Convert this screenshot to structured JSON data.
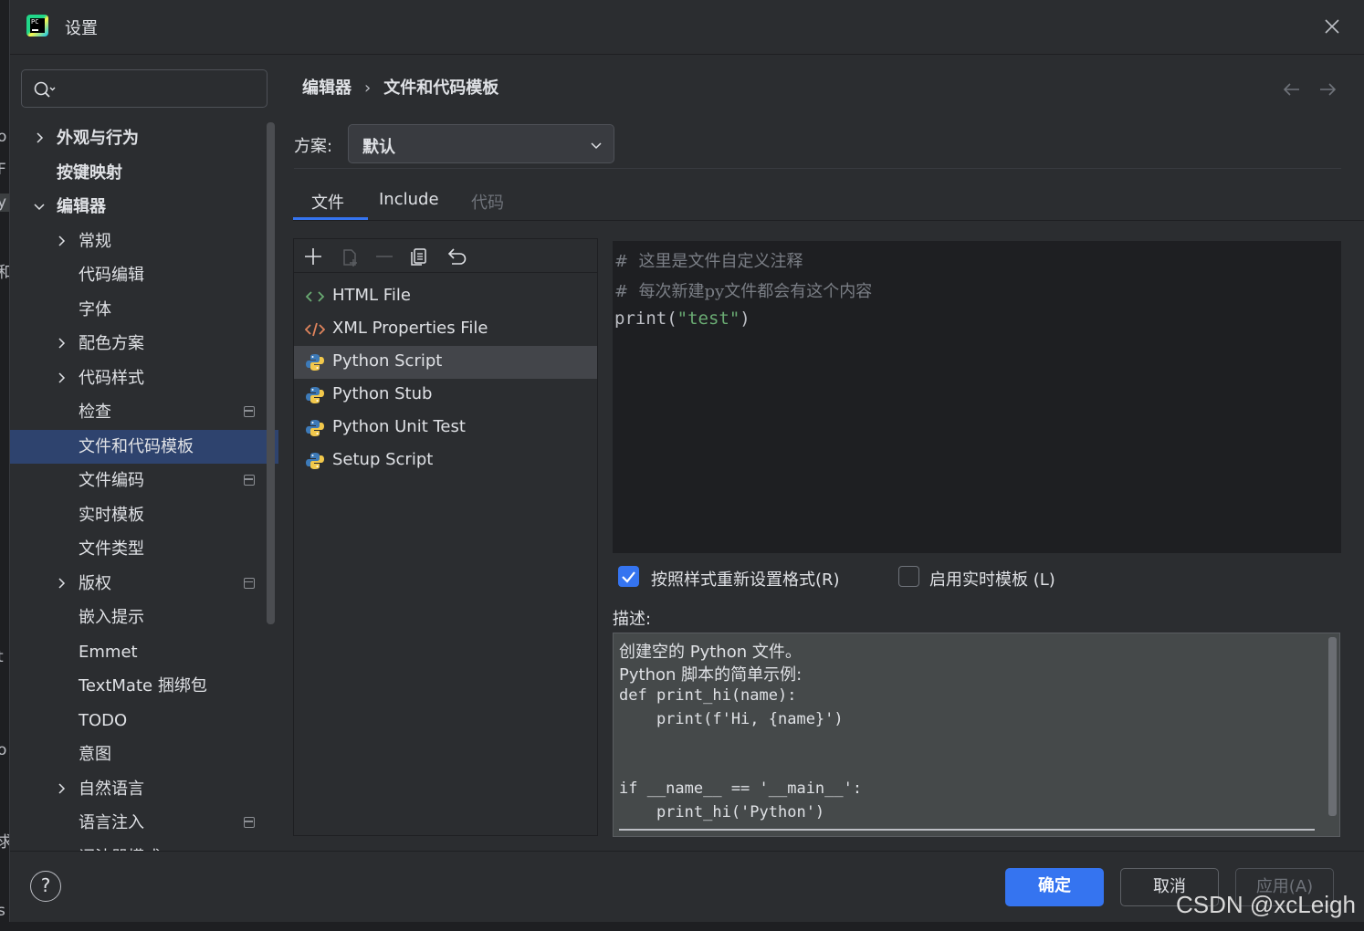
{
  "window": {
    "title": "设置"
  },
  "left_edge_fragments": [
    "o",
    "F",
    "y",
    "和",
    "t",
    "o",
    "求",
    "s"
  ],
  "search": {
    "placeholder": ""
  },
  "tree": [
    {
      "label": "外观与行为",
      "level": 0,
      "chevron": "right",
      "bold": true
    },
    {
      "label": "按键映射",
      "level": 0,
      "chevron": "none",
      "bold": true
    },
    {
      "label": "编辑器",
      "level": 0,
      "chevron": "down",
      "bold": true
    },
    {
      "label": "常规",
      "level": 1,
      "chevron": "right"
    },
    {
      "label": "代码编辑",
      "level": 1,
      "chevron": "none"
    },
    {
      "label": "字体",
      "level": 1,
      "chevron": "none"
    },
    {
      "label": "配色方案",
      "level": 1,
      "chevron": "right"
    },
    {
      "label": "代码样式",
      "level": 1,
      "chevron": "right"
    },
    {
      "label": "检查",
      "level": 1,
      "chevron": "none",
      "project_icon": true
    },
    {
      "label": "文件和代码模板",
      "level": 1,
      "chevron": "none",
      "selected": true
    },
    {
      "label": "文件编码",
      "level": 1,
      "chevron": "none",
      "project_icon": true
    },
    {
      "label": "实时模板",
      "level": 1,
      "chevron": "none"
    },
    {
      "label": "文件类型",
      "level": 1,
      "chevron": "none"
    },
    {
      "label": "版权",
      "level": 1,
      "chevron": "right",
      "project_icon": true
    },
    {
      "label": "嵌入提示",
      "level": 1,
      "chevron": "none"
    },
    {
      "label": "Emmet",
      "level": 1,
      "chevron": "none"
    },
    {
      "label": "TextMate 捆绑包",
      "level": 1,
      "chevron": "none"
    },
    {
      "label": "TODO",
      "level": 1,
      "chevron": "none"
    },
    {
      "label": "意图",
      "level": 1,
      "chevron": "none"
    },
    {
      "label": "自然语言",
      "level": 1,
      "chevron": "right"
    },
    {
      "label": "语言注入",
      "level": 1,
      "chevron": "none",
      "project_icon": true
    },
    {
      "label": "词法器模式",
      "level": 1,
      "chevron": "none",
      "project_icon": true
    }
  ],
  "breadcrumb": {
    "parent": "编辑器",
    "separator": "›",
    "current": "文件和代码模板"
  },
  "scheme": {
    "label": "方案:",
    "value": "默认"
  },
  "tabs": [
    {
      "label": "文件",
      "active": true,
      "disabled": false
    },
    {
      "label": "Include",
      "active": false,
      "disabled": false
    },
    {
      "label": "代码",
      "active": false,
      "disabled": true
    }
  ],
  "toolbar": [
    "add-icon",
    "copy-template-icon",
    "remove-icon",
    "duplicate-icon",
    "reset-icon"
  ],
  "templates": [
    {
      "label": "HTML File",
      "icon": "html-icon"
    },
    {
      "label": "XML Properties File",
      "icon": "xml-icon"
    },
    {
      "label": "Python Script",
      "icon": "python-icon",
      "selected": true
    },
    {
      "label": "Python Stub",
      "icon": "python-icon"
    },
    {
      "label": "Python Unit Test",
      "icon": "python-icon"
    },
    {
      "label": "Setup Script",
      "icon": "python-icon"
    }
  ],
  "editor": {
    "comment1": "#  这里是文件自定义注释",
    "comment2": "#  每次新建py文件都会有这个内容",
    "code_prefix": "print(",
    "code_string": "\"test\"",
    "code_suffix": ")"
  },
  "options": {
    "reformat_label": "按照样式重新设置格式(R)",
    "reformat_checked": true,
    "live_templates_label": "启用实时模板 (L)",
    "live_templates_checked": false
  },
  "description": {
    "label": "描述:",
    "line1": "创建空的 Python 文件。",
    "line2": "Python 脚本的简单示例:",
    "code1": "def print_hi(name):",
    "code2": "    print(f'Hi, {name}')",
    "code3": "if __name__ == '__main__':",
    "code4": "    print_hi('Python')"
  },
  "buttons": {
    "help": "?",
    "ok": "确定",
    "cancel": "取消",
    "apply": "应用(A)"
  },
  "watermark": "CSDN @xcLeigh",
  "colors": {
    "accent": "#3574f0",
    "selected_tree": "#2e436e",
    "string": "#6aab73",
    "comment": "#7a7e85"
  }
}
